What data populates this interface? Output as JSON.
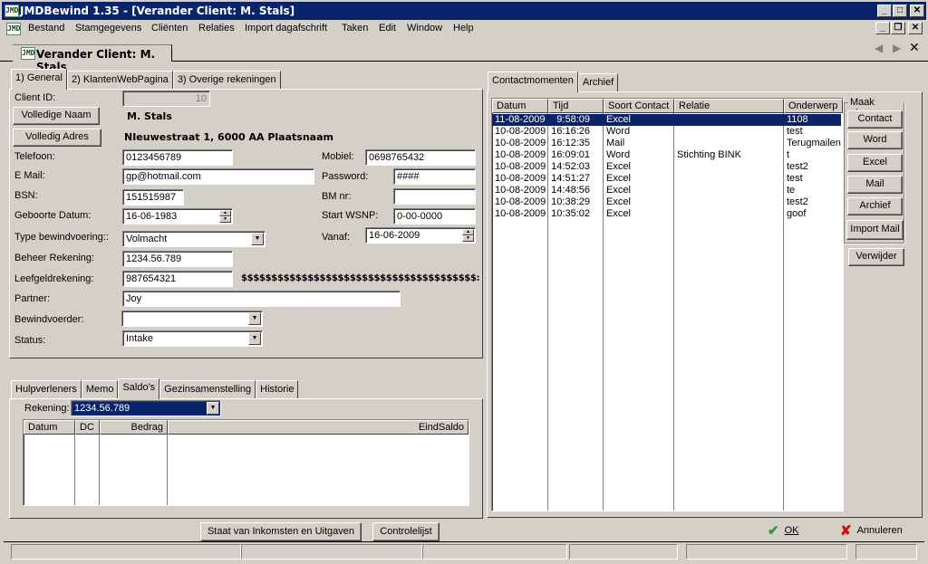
{
  "window": {
    "title": "JMDBewind 1.35 - [Verander Client: M. Stals]",
    "icon": "jmd-logo-icon",
    "controls": [
      "minimize",
      "maximize",
      "close"
    ],
    "mdi_controls": [
      "minimize",
      "restore",
      "close"
    ]
  },
  "menu": {
    "items": [
      {
        "label": "Bestand",
        "accel": "B"
      },
      {
        "label": "Stamgegevens"
      },
      {
        "label": "Cliënten"
      },
      {
        "label": "Relaties"
      },
      {
        "label": "Import dagafschrift"
      },
      {
        "label": "Taken"
      },
      {
        "label": "Edit",
        "accel": "E"
      },
      {
        "label": "Window",
        "accel": "W"
      },
      {
        "label": "Help",
        "accel": "H"
      }
    ]
  },
  "doc_tab": {
    "label": "Verander Client: M. Stals"
  },
  "main_tabs": [
    {
      "label": "1) General",
      "active": true
    },
    {
      "label": "2) KlantenWebPagina"
    },
    {
      "label": "3) Overige rekeningen"
    }
  ],
  "general": {
    "client_id_label": "Client ID:",
    "client_id": "10",
    "volledige_naam_button": "Volledige Naam",
    "naam": "M. Stals",
    "volledig_adres_button": "Volledig Adres",
    "adres": "NIeuwestraat 1, 6000 AA Plaatsnaam",
    "telefoon_label": "Telefoon:",
    "telefoon": "0123456789",
    "email_label": "E Mail:",
    "email": "gp@hotmail.com",
    "bsn_label": "BSN:",
    "bsn": "151515987",
    "geboorte_label": "Geboorte Datum:",
    "geboorte": "16-06-1983",
    "type_label": "Type bewindvoering::",
    "type": "Volmacht",
    "beheer_label": "Beheer Rekening:",
    "beheer": "1234.56.789",
    "leefgeld_label": "Leefgeldrekening:",
    "leefgeld": "987654321",
    "dollar_text": "$$$$$$$$$$$$$$$$$$$$$$$$$$$$$$$$$$$$$$$:",
    "partner_label": "Partner:",
    "partner": "Joy",
    "bewindvoerder_label": "Bewindvoerder:",
    "bewindvoerder": "",
    "status_label": "Status:",
    "status": "Intake",
    "mobiel_label": "Mobiel:",
    "mobiel": "0698765432",
    "password_label": "Password:",
    "password": "####",
    "bm_label": "BM nr:",
    "bm": "",
    "wsnp_label": "Start WSNP:",
    "wsnp": "0-00-0000",
    "vanaf_label": "Vanaf:",
    "vanaf": "16-06-2009"
  },
  "lower_tabs": [
    {
      "label": "Hulpverleners"
    },
    {
      "label": "Memo"
    },
    {
      "label": "Saldo's",
      "active": true
    },
    {
      "label": "Gezinsamenstelling"
    },
    {
      "label": "Historie"
    }
  ],
  "saldos": {
    "rekening_label": "Rekening:",
    "rekening": "1234.56.789",
    "columns": [
      "Datum",
      "DC",
      "Bedrag",
      "EindSaldo"
    ],
    "rows": []
  },
  "contact_tabs": [
    {
      "label": "Contactmomenten",
      "active": true
    },
    {
      "label": "Archief"
    }
  ],
  "contacts": {
    "columns": [
      "Datum",
      "Tijd",
      "Soort Contact",
      "Relatie",
      "Onderwerp"
    ],
    "rows": [
      {
        "datum": "11-08-2009",
        "tijd": "9:58:09",
        "soort": "Excel",
        "relatie": "",
        "onderwerp": "1108",
        "selected": true
      },
      {
        "datum": "10-08-2009",
        "tijd": "16:16:26",
        "soort": "Word",
        "relatie": "",
        "onderwerp": "test"
      },
      {
        "datum": "10-08-2009",
        "tijd": "16:12:35",
        "soort": "Mail",
        "relatie": "",
        "onderwerp": "Terugmailen"
      },
      {
        "datum": "10-08-2009",
        "tijd": "16:09:01",
        "soort": "Word",
        "relatie": "Stichting BINK",
        "onderwerp": "t"
      },
      {
        "datum": "10-08-2009",
        "tijd": "14:52:03",
        "soort": "Excel",
        "relatie": "",
        "onderwerp": "test2"
      },
      {
        "datum": "10-08-2009",
        "tijd": "14:51:27",
        "soort": "Excel",
        "relatie": "",
        "onderwerp": "test"
      },
      {
        "datum": "10-08-2009",
        "tijd": "14:48:56",
        "soort": "Excel",
        "relatie": "",
        "onderwerp": "te"
      },
      {
        "datum": "10-08-2009",
        "tijd": "10:38:29",
        "soort": "Excel",
        "relatie": "",
        "onderwerp": "test2"
      },
      {
        "datum": "10-08-2009",
        "tijd": "10:35:02",
        "soort": "Excel",
        "relatie": "",
        "onderwerp": "goof"
      }
    ]
  },
  "maak_nieuw": {
    "legend": "Maak nieuw",
    "buttons": [
      "Contact",
      "Word",
      "Excel",
      "Mail",
      "Archief",
      "Import Mail"
    ],
    "verwijder": "Verwijder"
  },
  "footer": {
    "staat_button": "Staat van Inkomsten en Uitgaven",
    "controlelijst_button": "Controlelijst",
    "ok_button": "OK",
    "annuleren_button": "Annuleren",
    "ok_color": "#2a9a2a",
    "cancel_color": "#cc1111"
  },
  "colors": {
    "titlebar": "#0a246a",
    "selection": "#0a246a",
    "face": "#d4d0c8"
  }
}
